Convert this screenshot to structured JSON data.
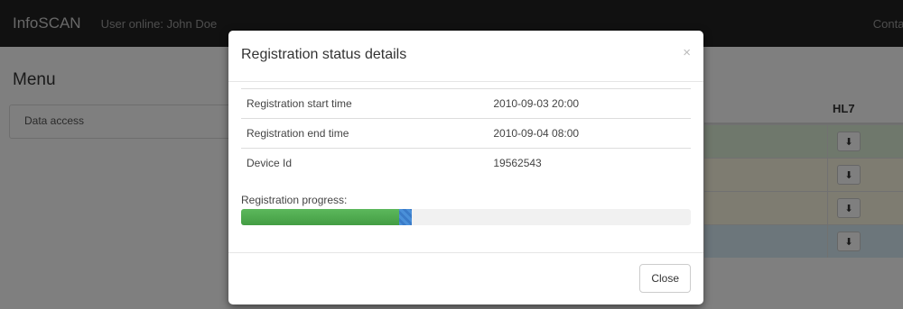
{
  "navbar": {
    "brand": "InfoSCAN",
    "user_online": "User online: John Doe",
    "contact": "Contac"
  },
  "menu": {
    "title": "Menu",
    "items": [
      {
        "label": "Data access"
      }
    ]
  },
  "background_table": {
    "header_hl7": "HL7",
    "rows": [
      {
        "color": "#dff0d8"
      },
      {
        "color": "#fcf8e3"
      },
      {
        "color": "#fcf8e3"
      },
      {
        "color": "#d9edf7"
      }
    ],
    "download_icon": "download-icon"
  },
  "modal": {
    "title": "Registration status details",
    "close_x": "×",
    "details": [
      {
        "label": "Registration start time",
        "value": "2010-09-03 20:00"
      },
      {
        "label": "Registration end time",
        "value": "2010-09-04 08:00"
      },
      {
        "label": "Device Id",
        "value": "19562543"
      }
    ],
    "progress_label": "Registration progress:",
    "progress_fraction": 0.38,
    "close_button": "Close"
  },
  "colors": {
    "navbar": "#222222",
    "progress_green": "#5cb85c",
    "progress_blue": "#4a90d9"
  }
}
